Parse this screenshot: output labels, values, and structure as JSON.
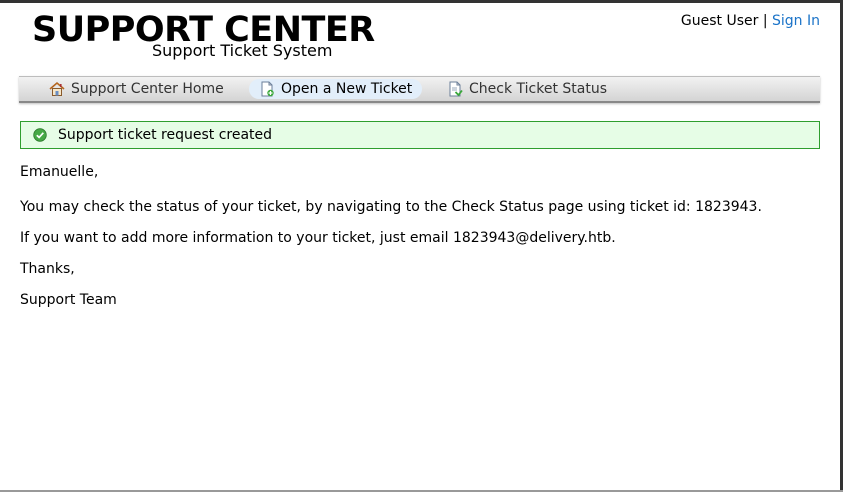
{
  "header": {
    "logo_title": "SUPPORT CENTER",
    "logo_subtitle": "Support Ticket System",
    "user_label": "Guest User",
    "separator": "|",
    "sign_in_label": "Sign In"
  },
  "nav": {
    "items": [
      {
        "label": "Support Center Home",
        "icon": "home-icon"
      },
      {
        "label": "Open a New Ticket",
        "icon": "new-ticket-icon",
        "active": true
      },
      {
        "label": "Check Ticket Status",
        "icon": "ticket-status-icon"
      }
    ]
  },
  "notice": {
    "icon": "success-check-icon",
    "text": "Support ticket request created"
  },
  "message": {
    "greeting": "Emanuelle,",
    "line1": "You may check the status of your ticket, by navigating to the Check Status page using ticket id: 1823943.",
    "line2": "If you want to add more information to your ticket, just email 1823943@delivery.htb.",
    "thanks": "Thanks,",
    "signature": "Support Team"
  },
  "colors": {
    "link": "#1a73c8",
    "notice_bg": "#e6fde6",
    "notice_border": "#2f9e2f",
    "active_tab_bg": "#e2eefa"
  }
}
